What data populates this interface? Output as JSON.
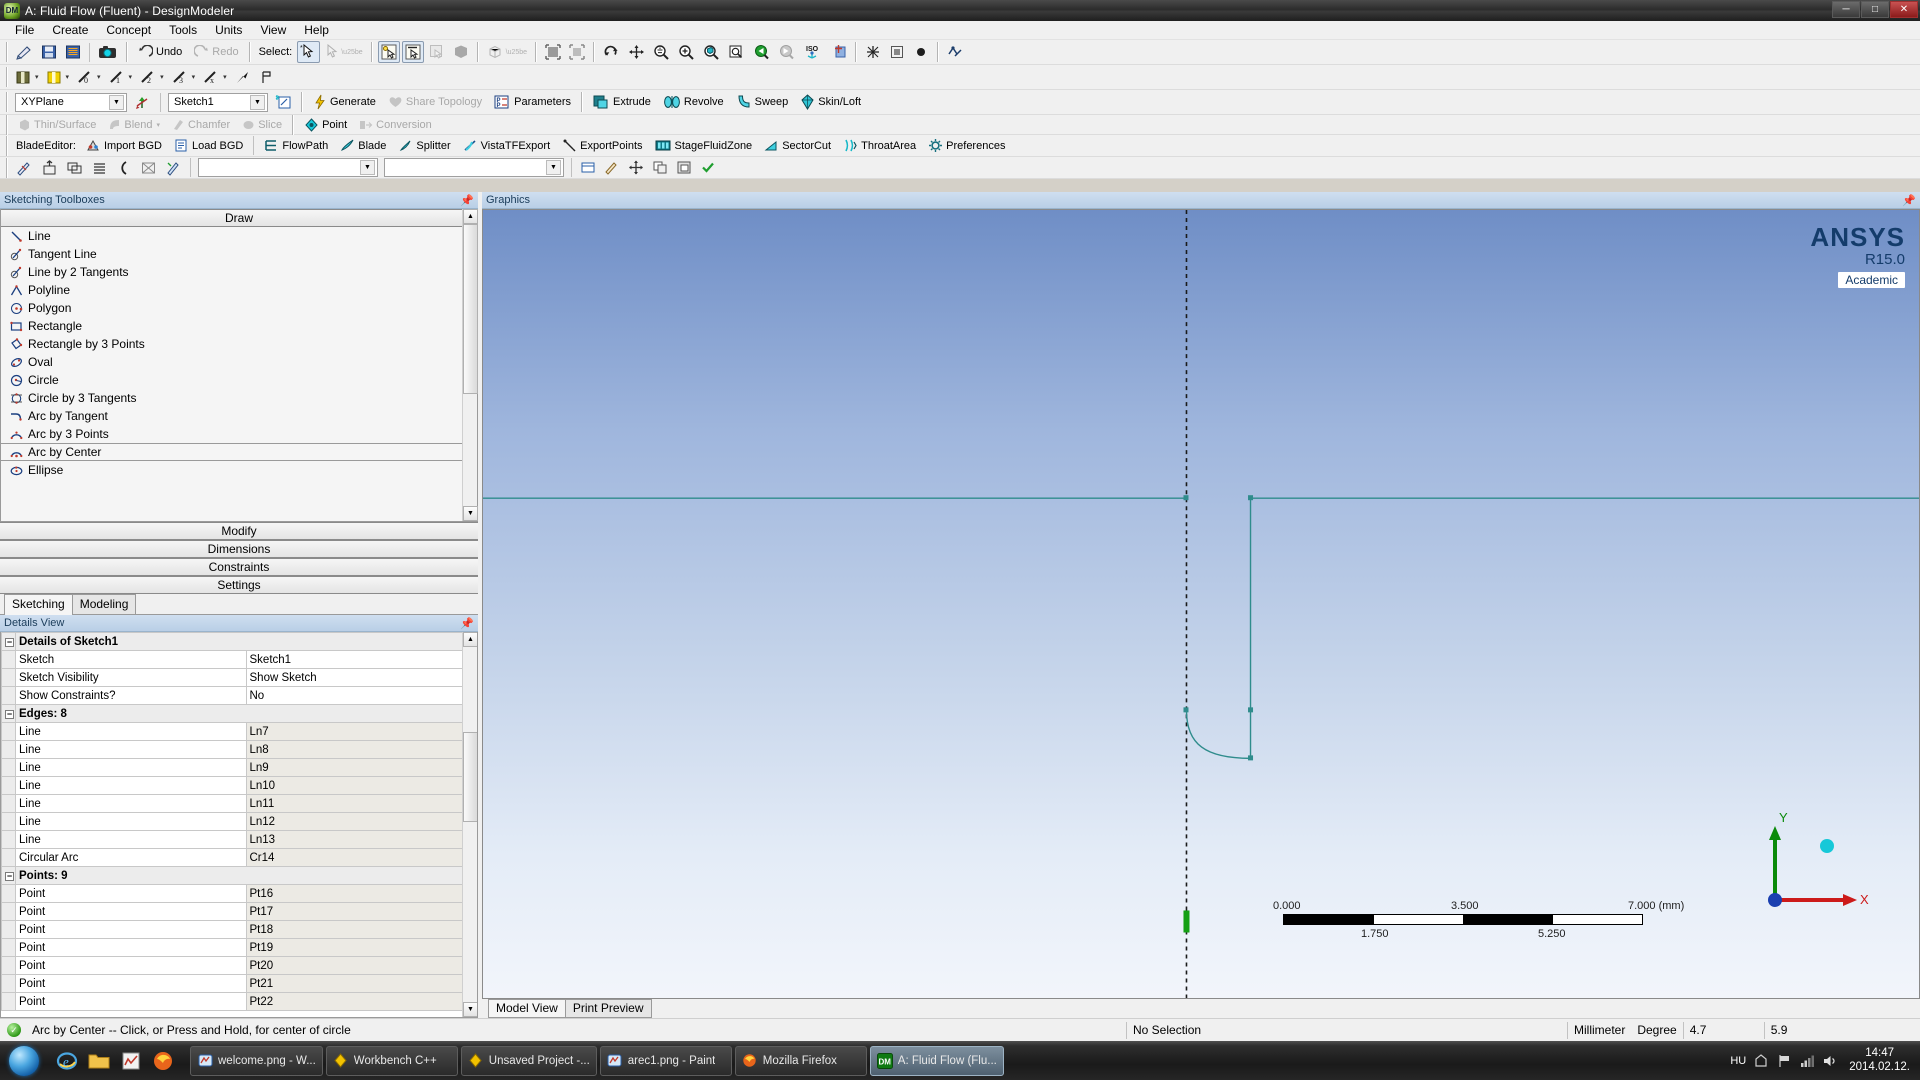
{
  "window": {
    "title": "A: Fluid Flow (Fluent) - DesignModeler",
    "app_icon": "designmodeler-icon",
    "buttons": {
      "minimize": "─",
      "maximize": "□",
      "close": "✕"
    }
  },
  "menu": {
    "items": [
      "File",
      "Create",
      "Concept",
      "Tools",
      "Units",
      "View",
      "Help"
    ]
  },
  "toolbar_main": {
    "icons": [
      {
        "name": "new-sketch-icon",
        "glyph": "✎"
      },
      {
        "name": "save-project-icon",
        "glyph": "▤"
      },
      {
        "name": "save-as-icon",
        "glyph": "▥"
      },
      {
        "name": "screenshot-icon",
        "glyph": "▣"
      }
    ],
    "undo_label": "Undo",
    "redo_label": "Redo",
    "select_label": "Select:",
    "select_modes": [
      "single-select",
      "box-select"
    ],
    "filters": [
      "select-points",
      "select-edges",
      "select-faces",
      "select-bodies"
    ],
    "view_icons": [
      "rotate",
      "pan",
      "zoom",
      "box-zoom",
      "zoom-to-fit",
      "magnify",
      "previous-view",
      "next-view",
      "iso-view",
      "look-at"
    ]
  },
  "toolbar_sketch": {
    "items": [
      {
        "name": "new-plane-icon",
        "glyph": "▤"
      },
      {
        "name": "new-sketch-icon",
        "glyph": "▥"
      },
      {
        "name": "extrude-0-icon",
        "glyph": "0"
      },
      {
        "name": "extrude-1-icon",
        "glyph": "1"
      },
      {
        "name": "extrude-2-icon",
        "glyph": "2"
      },
      {
        "name": "extrude-3-icon",
        "glyph": "3"
      },
      {
        "name": "extrude-x-icon",
        "glyph": "x"
      },
      {
        "name": "point-arrow-icon",
        "glyph": "➤"
      },
      {
        "name": "flag-icon",
        "glyph": "⚑"
      }
    ]
  },
  "toolbar_plane": {
    "plane_value": "XYPlane",
    "sketch_value": "Sketch1",
    "new_plane_icon": "new-plane-icon",
    "new_sketch_icon": "new-sketch-icon",
    "generate_label": "Generate",
    "share_topology_label": "Share Topology",
    "parameters_label": "Parameters",
    "extrude_label": "Extrude",
    "revolve_label": "Revolve",
    "sweep_label": "Sweep",
    "skin_loft_label": "Skin/Loft"
  },
  "toolbar_feature": {
    "thin_surface_label": "Thin/Surface",
    "blend_label": "Blend",
    "chamfer_label": "Chamfer",
    "slice_label": "Slice",
    "point_label": "Point",
    "conversion_label": "Conversion"
  },
  "toolbar_blade": {
    "title": "BladeEditor:",
    "items": [
      {
        "label": "Import BGD",
        "icon": "import-bgd-icon"
      },
      {
        "label": "Load BGD",
        "icon": "load-bgd-icon"
      },
      {
        "label": "FlowPath",
        "icon": "flowpath-icon"
      },
      {
        "label": "Blade",
        "icon": "blade-icon"
      },
      {
        "label": "Splitter",
        "icon": "splitter-icon"
      },
      {
        "label": "VistaTFExport",
        "icon": "vista-tf-export-icon"
      },
      {
        "label": "ExportPoints",
        "icon": "export-points-icon"
      },
      {
        "label": "StageFluidZone",
        "icon": "stage-fluid-zone-icon"
      },
      {
        "label": "SectorCut",
        "icon": "sector-cut-icon"
      },
      {
        "label": "ThroatArea",
        "icon": "throat-area-icon"
      },
      {
        "label": "Preferences",
        "icon": "preferences-icon"
      }
    ]
  },
  "toolbar_sketch_tools": {
    "icons": [
      {
        "name": "sketch-projection-icon",
        "glyph": "✐"
      },
      {
        "name": "sketch-extrude-icon",
        "glyph": "↥"
      },
      {
        "name": "sketch-copy-icon",
        "glyph": "⧉"
      },
      {
        "name": "sketch-list-icon",
        "glyph": "≡"
      },
      {
        "name": "sketch-arc-icon",
        "glyph": "("
      },
      {
        "name": "sketch-box-icon",
        "glyph": "▧"
      },
      {
        "name": "sketch-instance-icon",
        "glyph": "⌘"
      }
    ],
    "combo1_value": "",
    "combo2_value": "",
    "right_icons": [
      {
        "name": "dim-display-icon",
        "glyph": "▤"
      },
      {
        "name": "dim-edit-icon",
        "glyph": "✐"
      },
      {
        "name": "dim-move-icon",
        "glyph": "✥"
      },
      {
        "name": "dim-copy-icon",
        "glyph": "⧉"
      },
      {
        "name": "dim-paste-icon",
        "glyph": "▨"
      },
      {
        "name": "dim-apply-icon",
        "glyph": "✔"
      }
    ]
  },
  "sketching_toolboxes": {
    "header": "Sketching Toolboxes",
    "pin_icon": "pin-icon",
    "draw_group": "Draw",
    "draw_items": [
      {
        "label": "Line",
        "icon": "line-icon"
      },
      {
        "label": "Tangent Line",
        "icon": "tangent-line-icon"
      },
      {
        "label": "Line by 2 Tangents",
        "icon": "line-by-2-tangents-icon"
      },
      {
        "label": "Polyline",
        "icon": "polyline-icon"
      },
      {
        "label": "Polygon",
        "icon": "polygon-icon"
      },
      {
        "label": "Rectangle",
        "icon": "rectangle-icon"
      },
      {
        "label": "Rectangle by 3 Points",
        "icon": "rectangle-by-3-points-icon"
      },
      {
        "label": "Oval",
        "icon": "oval-icon"
      },
      {
        "label": "Circle",
        "icon": "circle-icon"
      },
      {
        "label": "Circle by 3 Tangents",
        "icon": "circle-by-3-tangents-icon"
      },
      {
        "label": "Arc by Tangent",
        "icon": "arc-by-tangent-icon"
      },
      {
        "label": "Arc by 3 Points",
        "icon": "arc-by-3-points-icon"
      },
      {
        "label": "Arc by Center",
        "icon": "arc-by-center-icon",
        "selected": true
      },
      {
        "label": "Ellipse",
        "icon": "ellipse-icon"
      }
    ],
    "collapsed_groups": [
      "Modify",
      "Dimensions",
      "Constraints",
      "Settings"
    ],
    "tabs": [
      {
        "label": "Sketching",
        "active": true
      },
      {
        "label": "Modeling",
        "active": false
      }
    ]
  },
  "details_view": {
    "header": "Details View",
    "pin_icon": "pin-icon",
    "groups": [
      {
        "title": "Details of Sketch1",
        "rows": [
          {
            "key": "Sketch",
            "value": "Sketch1"
          },
          {
            "key": "Sketch Visibility",
            "value": "Show Sketch"
          },
          {
            "key": "Show Constraints?",
            "value": "No"
          }
        ]
      },
      {
        "title": "Edges: 8",
        "rows": [
          {
            "key": "Line",
            "value": "Ln7"
          },
          {
            "key": "Line",
            "value": "Ln8"
          },
          {
            "key": "Line",
            "value": "Ln9"
          },
          {
            "key": "Line",
            "value": "Ln10"
          },
          {
            "key": "Line",
            "value": "Ln11"
          },
          {
            "key": "Line",
            "value": "Ln12"
          },
          {
            "key": "Line",
            "value": "Ln13"
          },
          {
            "key": "Circular Arc",
            "value": "Cr14"
          }
        ]
      },
      {
        "title": "Points: 9",
        "rows": [
          {
            "key": "Point",
            "value": "Pt16"
          },
          {
            "key": "Point",
            "value": "Pt17"
          },
          {
            "key": "Point",
            "value": "Pt18"
          },
          {
            "key": "Point",
            "value": "Pt19"
          },
          {
            "key": "Point",
            "value": "Pt20"
          },
          {
            "key": "Point",
            "value": "Pt21"
          },
          {
            "key": "Point",
            "value": "Pt22"
          }
        ]
      }
    ]
  },
  "graphics": {
    "header": "Graphics",
    "pin_icon": "pin-icon",
    "logo": {
      "name": "ANSYS",
      "release": "R15.0",
      "badge": "Academic"
    },
    "ruler": {
      "top_labels": [
        "0.000",
        "3.500",
        "7.000 (mm)"
      ],
      "bottom_labels": [
        "1.750",
        "5.250"
      ]
    },
    "triad": {
      "x_label": "X",
      "y_label": "Y"
    },
    "view_tabs": [
      {
        "label": "Model View",
        "active": true
      },
      {
        "label": "Print Preview",
        "active": false
      }
    ]
  },
  "statusbar": {
    "hint": "Arc by Center -- Click, or Press and Hold, for center of circle",
    "selection": "No Selection",
    "unit_length": "Millimeter",
    "unit_angle": "Degree",
    "value1": "4.7",
    "value2": "5.9"
  },
  "taskbar": {
    "start_icon": "windows-start-icon",
    "quick_launch": [
      {
        "name": "internet-explorer-icon",
        "glyph": "e"
      },
      {
        "name": "explorer-folder-icon",
        "glyph": "🗀"
      },
      {
        "name": "firefox-icon",
        "glyph": "◐"
      },
      {
        "name": "presentation-icon",
        "glyph": "▤"
      }
    ],
    "tasks": [
      {
        "label": "welcome.png - W...",
        "icon": "paint-icon",
        "active": false
      },
      {
        "label": "Workbench C++",
        "icon": "workbench-icon",
        "active": false
      },
      {
        "label": "Unsaved Project -...",
        "icon": "workbench-icon",
        "active": false
      },
      {
        "label": "arec1.png - Paint",
        "icon": "paint-icon",
        "active": false
      },
      {
        "label": "Mozilla Firefox",
        "icon": "firefox-icon",
        "active": false
      },
      {
        "label": "A: Fluid Flow (Flu...",
        "icon": "designmodeler-icon",
        "active": true
      }
    ],
    "tray": {
      "language": "HU",
      "icons": [
        "show-desktop-icon",
        "flag-icon",
        "network-icon",
        "volume-icon"
      ],
      "time": "14:47",
      "date": "2014.02.12."
    }
  },
  "colors": {
    "accent": "#1a3c5a",
    "sketch_line": "#3f8f8f",
    "title_bg": "#2c2c2c",
    "panel_bg": "#f0f0f0",
    "graphics_top": "#6f8ec6",
    "graphics_bottom": "#f2f5fb"
  }
}
